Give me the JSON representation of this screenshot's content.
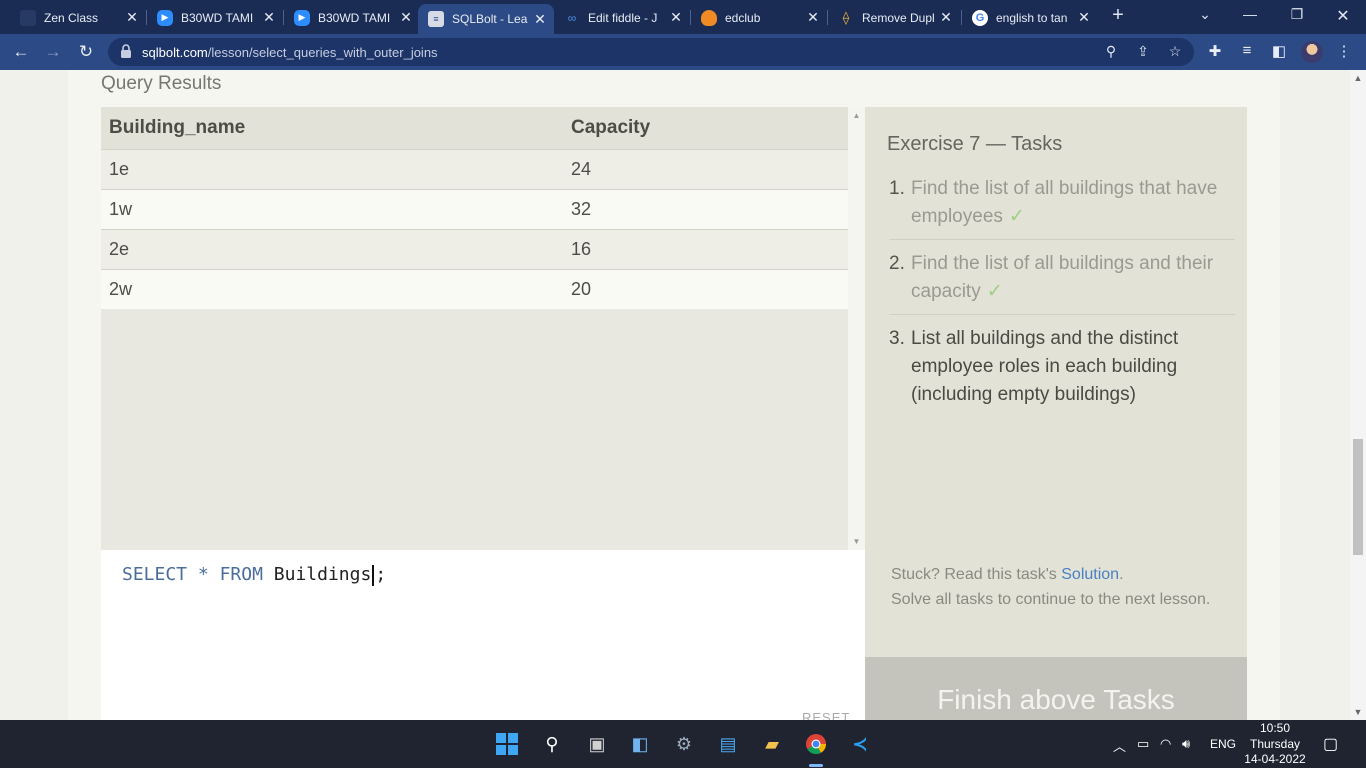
{
  "browser": {
    "tabs": [
      {
        "title": "Zen Class",
        "icon": "zen-icon"
      },
      {
        "title": "B30WD TAMI",
        "icon": "zoom-icon"
      },
      {
        "title": "B30WD TAMI",
        "icon": "zoom-icon"
      },
      {
        "title": "SQLBolt - Lea",
        "icon": "sqlbolt-icon",
        "active": true
      },
      {
        "title": "Edit fiddle - J",
        "icon": "jsfiddle-icon"
      },
      {
        "title": "edclub",
        "icon": "edclub-icon"
      },
      {
        "title": "Remove Dupl",
        "icon": "remove-dup-icon"
      },
      {
        "title": "english to tan",
        "icon": "google-icon"
      }
    ],
    "url_host": "sqlbolt.com",
    "url_path": "/lesson/select_queries_with_outer_joins"
  },
  "page": {
    "results_title": "Query Results",
    "columns": [
      "Building_name",
      "Capacity"
    ],
    "rows": [
      [
        "1e",
        "24"
      ],
      [
        "1w",
        "32"
      ],
      [
        "2e",
        "16"
      ],
      [
        "2w",
        "20"
      ]
    ],
    "query": {
      "kw1": "SELECT",
      "star": "*",
      "kw2": "FROM",
      "table": "Buildings",
      "end": ";"
    },
    "reset_label": "RESET",
    "tasks_title": "Exercise 7 — Tasks",
    "tasks": [
      {
        "num": "1.",
        "text": "Find the list of all buildings that have employees",
        "done": true
      },
      {
        "num": "2.",
        "text": "Find the list of all buildings and their capacity",
        "done": true
      },
      {
        "num": "3.",
        "text": "List all buildings and the distinct employee roles in each building (including empty buildings)",
        "done": false
      }
    ],
    "check_mark": "✓",
    "stuck_prefix": "Stuck? Read this task's ",
    "solution_link": "Solution",
    "stuck_suffix": ".",
    "continue_text": "Solve all tasks to continue to the next lesson.",
    "finish_button": "Finish above Tasks"
  },
  "taskbar": {
    "lang": "ENG",
    "time": "10:50",
    "day": "Thursday",
    "date": "14-04-2022"
  }
}
